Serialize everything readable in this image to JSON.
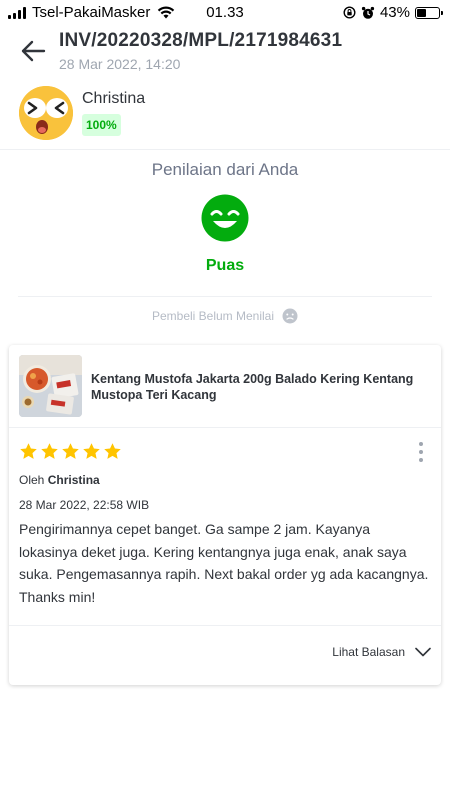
{
  "status_bar": {
    "carrier": "Tsel-PakaiMasker",
    "time": "01.33",
    "battery": "43%",
    "battery_level": 0.43
  },
  "header": {
    "invoice": "INV/20220328/MPL/2171984631",
    "date": "28 Mar 2022, 14:20",
    "back_icon": "arrow-left-icon"
  },
  "seller": {
    "name": "Christina",
    "badge": "100%",
    "avatar_icon": "cartoon-face-avatar"
  },
  "rating": {
    "title": "Penilaian dari Anda",
    "label": "Puas",
    "face_icon": "smile-face-icon",
    "buyer_status": "Pembeli Belum Menilai",
    "buyer_status_icon": "neutral-face-icon"
  },
  "review": {
    "product_name": "Kentang Mustofa Jakarta 200g Balado Kering Kentang Mustopa Teri Kacang",
    "stars": 5,
    "by_prefix": "Oleh",
    "reviewer": "Christina",
    "date": "28 Mar 2022, 22:58 WIB",
    "text": "Pengirimannya cepet banget. Ga sampe 2 jam. Kayanya lokasinya deket juga. Kering kentangnya juga enak, anak saya suka. Pengemasannya rapih. Next bakal order yg ada kacangnya. Thanks min!",
    "reply_label": "Lihat Balasan"
  },
  "colors": {
    "accent_green": "#03ac0e",
    "badge_bg": "#d6ffde",
    "star": "#ffc400",
    "text_main": "#31353b",
    "text_muted": "#9fa6b0"
  }
}
